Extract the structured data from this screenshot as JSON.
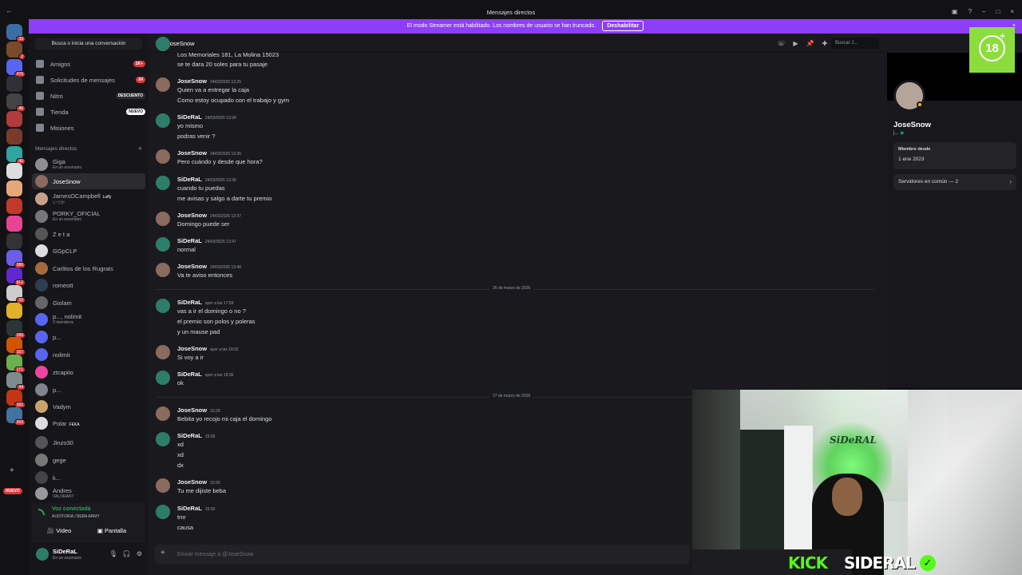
{
  "window": {
    "title": "Mensajes directos"
  },
  "banner": {
    "text": "El modo Streamer está habilitado. Los nombres de usuario se han truncado.",
    "button": "Deshabilitar"
  },
  "rail": {
    "new_label": "NUEVO",
    "servers": [
      {
        "color": "#3a6ea5",
        "badge": "33"
      },
      {
        "color": "#7a4a2b",
        "badge": "2"
      },
      {
        "color": "#5865f2",
        "badge": "476"
      },
      {
        "color": "#2f3136",
        "badge": ""
      },
      {
        "color": "#444",
        "badge": "46"
      },
      {
        "color": "#b23b3b",
        "badge": ""
      },
      {
        "color": "#7a3b2b",
        "badge": ""
      },
      {
        "color": "#2fa4a0",
        "badge": "46"
      },
      {
        "color": "#ddd",
        "badge": ""
      },
      {
        "color": "#e8a77a",
        "badge": ""
      },
      {
        "color": "#c0392b",
        "badge": ""
      },
      {
        "color": "#e84393",
        "badge": ""
      },
      {
        "color": "#333",
        "badge": ""
      },
      {
        "color": "#6c5ce7",
        "badge": "386"
      },
      {
        "color": "#5f27cd",
        "badge": "812"
      },
      {
        "color": "#ccc",
        "badge": "10"
      },
      {
        "color": "#e1b12c",
        "badge": ""
      },
      {
        "color": "#2d3436",
        "badge": "150"
      },
      {
        "color": "#d35400",
        "badge": "157"
      },
      {
        "color": "#6ab04c",
        "badge": "171"
      },
      {
        "color": "#7f8c8d",
        "badge": "44"
      },
      {
        "color": "#c23616",
        "badge": "161"
      },
      {
        "color": "#40739e",
        "badge": "263"
      }
    ]
  },
  "dm_sidebar": {
    "search_label": "Busca o inicia una conversación",
    "nav": [
      {
        "label": "Amigos",
        "pill": "1K+",
        "pill_style": "red"
      },
      {
        "label": "Solicitudes de mensajes",
        "pill": "64",
        "pill_style": "red"
      },
      {
        "label": "Nitro",
        "pill": "DESCUENTO",
        "pill_style": "dark"
      },
      {
        "label": "Tienda",
        "pill": "NUEVO",
        "pill_style": "white"
      },
      {
        "label": "Misiones",
        "pill": "",
        "pill_style": ""
      }
    ],
    "dm_header": "Mensajes directos",
    "dms": [
      {
        "name": "Giga",
        "sub": "En un escenario",
        "tag": "",
        "color": "#8e8e8e"
      },
      {
        "name": "JoseSnow",
        "sub": "",
        "tag": "",
        "color": "#8b6a60"
      },
      {
        "name": "JamesOCampbell",
        "sub": "いつか",
        "tag": "Luffy",
        "color": "#c7a08a"
      },
      {
        "name": "PORKY_OFICIAL",
        "sub": "En un escenario",
        "tag": "",
        "color": "#777"
      },
      {
        "name": "Z e t a",
        "sub": "",
        "tag": "",
        "color": "#555"
      },
      {
        "name": "GGpCLP",
        "sub": "",
        "tag": "",
        "color": "#ddd"
      },
      {
        "name": "Carlitos de los Rugrats",
        "sub": "",
        "tag": "",
        "color": "#a36a3f"
      },
      {
        "name": "romeott",
        "sub": "",
        "tag": "",
        "color": "#2c3e50"
      },
      {
        "name": "Giolam",
        "sub": "",
        "tag": "",
        "color": "#666"
      },
      {
        "name": "p..., nolimit",
        "sub": "3 miembros",
        "tag": "",
        "color": "#5865f2"
      },
      {
        "name": "p...",
        "sub": "",
        "tag": "",
        "color": "#5865f2"
      },
      {
        "name": "nolimit",
        "sub": "",
        "tag": "",
        "color": "#5865f2"
      },
      {
        "name": "ztcapito",
        "sub": "",
        "tag": "",
        "color": "#eb459e"
      },
      {
        "name": "p...",
        "sub": "",
        "tag": "",
        "color": "#80848e"
      },
      {
        "name": "Vadym",
        "sub": "",
        "tag": "",
        "color": "#c9a46a"
      },
      {
        "name": "Polar",
        "sub": "",
        "tag": "FEKA",
        "color": "#ddd"
      },
      {
        "name": "Jinzo30",
        "sub": "",
        "tag": "",
        "color": "#555"
      },
      {
        "name": "gege",
        "sub": "",
        "tag": "",
        "color": "#777"
      },
      {
        "name": "k...",
        "sub": "",
        "tag": "",
        "color": "#444"
      },
      {
        "name": "Andres",
        "sub": "VALORANT",
        "tag": "",
        "color": "#999"
      }
    ],
    "voice": {
      "status": "Voz conectada",
      "channel": "AUDITORIA / BEBA ARMY",
      "video_label": "Video",
      "screen_label": "Pantalla"
    },
    "user": {
      "name": "SiDeRaL",
      "status": "En un escenario"
    }
  },
  "chat": {
    "header_name": "JoseSnow",
    "search_placeholder": "Buscar J...",
    "composer_placeholder": "Enviar mensaje a @JoseSnow",
    "top_partial_line": "Los Memoriales 181, La Molina 15023",
    "top_partial_line2": "se te dara 20 soles para tu pasaje",
    "messages": [
      {
        "who": "JoseSnow",
        "ts": "24/03/2026 13:25",
        "lines": [
          "Quien va a entregar la caja",
          "Como estoy ocupado con el trabajo y gym"
        ]
      },
      {
        "who": "SiDeRaL",
        "ts": "24/03/2026 13:34",
        "lines": [
          "yo mismo",
          "podras venir ?"
        ]
      },
      {
        "who": "JoseSnow",
        "ts": "24/03/2026 13:36",
        "lines": [
          "Pero cuándo y desde que hora?"
        ]
      },
      {
        "who": "SiDeRaL",
        "ts": "24/03/2026 13:36",
        "lines": [
          "cuando tu puedas",
          "me avisas y salgo a darte tu premio"
        ]
      },
      {
        "who": "JoseSnow",
        "ts": "24/03/2026 13:37",
        "lines": [
          "Domingo puede ser"
        ]
      },
      {
        "who": "SiDeRaL",
        "ts": "24/03/2026 13:47",
        "lines": [
          "normal"
        ]
      },
      {
        "who": "JoseSnow",
        "ts": "24/03/2026 13:48",
        "lines": [
          "Va te aviso entonces"
        ]
      },
      {
        "who": "SiDeRaL",
        "ts": "ayer a las 17:59",
        "lines": [
          "vas a ir el domingo o no ?",
          "el premio son polos y poleras",
          "y un mause pad"
        ]
      },
      {
        "who": "JoseSnow",
        "ts": "ayer a las 18:02",
        "lines": [
          "Si voy a ir"
        ]
      },
      {
        "who": "SiDeRaL",
        "ts": "ayer a las 18:36",
        "lines": [
          "ok"
        ]
      },
      {
        "who": "JoseSnow",
        "ts": "15:28",
        "lines": [
          "Bebita yo recojo mi caja el domingo"
        ]
      },
      {
        "who": "SiDeRaL",
        "ts": "15:28",
        "lines": [
          "xd",
          "xd",
          "dx"
        ]
      },
      {
        "who": "JoseSnow",
        "ts": "15:30",
        "lines": [
          "Tu me dijiste beba"
        ]
      },
      {
        "who": "SiDeRaL",
        "ts": "15:30",
        "lines": [
          "tmr",
          "causa"
        ]
      }
    ],
    "dividers": [
      "26 de marzo de 2026",
      "27 de marzo de 2026"
    ]
  },
  "profile": {
    "name": "JoseSnow",
    "username": "j...",
    "member_since_label": "Miembro desde",
    "member_since": "1 ene 2023",
    "mutual_servers": "Servidores en común — 2"
  },
  "overlay": {
    "age_badge": "18",
    "brand": "KICK",
    "channel": "SIDERAL",
    "sign": "SiDeRAL"
  },
  "colors": {
    "accent": "#8c3ff6",
    "kick_green": "#53fc18",
    "online": "#23a55a",
    "mention_red": "#da373c"
  }
}
